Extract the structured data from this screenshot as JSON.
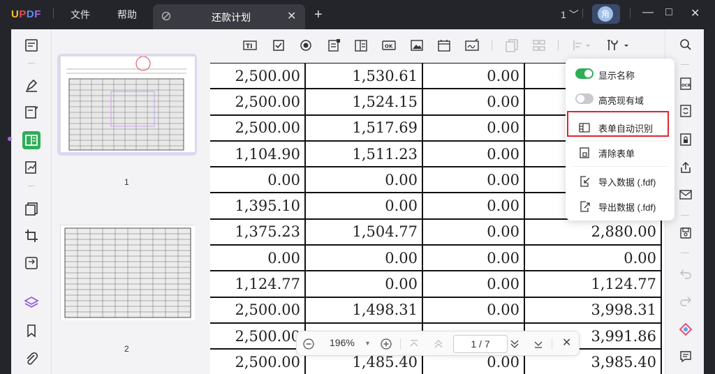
{
  "app": {
    "logo": "UPDF"
  },
  "menu": {
    "file": "文件",
    "help": "帮助"
  },
  "tab": {
    "title": "还款计划",
    "close": "✕"
  },
  "new_tab": "+",
  "page_selector": "1",
  "avatar_text": "角",
  "window": {
    "minimize": "—",
    "maximize": "□",
    "close": "✕"
  },
  "thumbnails": [
    {
      "number": "1"
    },
    {
      "number": "2"
    }
  ],
  "table_rows": [
    [
      "2,500.00",
      "1,530.61",
      "0.00",
      ""
    ],
    [
      "2,500.00",
      "1,524.15",
      "0.00",
      ""
    ],
    [
      "2,500.00",
      "1,517.69",
      "0.00",
      ""
    ],
    [
      "1,104.90",
      "1,511.23",
      "0.00",
      ""
    ],
    [
      "0.00",
      "0.00",
      "0.00",
      ""
    ],
    [
      "1,395.10",
      "0.00",
      "0.00",
      ""
    ],
    [
      "1,375.23",
      "1,504.77",
      "0.00",
      "2,880.00"
    ],
    [
      "0.00",
      "0.00",
      "0.00",
      "0.00"
    ],
    [
      "1,124.77",
      "0.00",
      "0.00",
      "1,124.77"
    ],
    [
      "2,500.00",
      "1,498.31",
      "0.00",
      "3,998.31"
    ],
    [
      "2,500.00",
      "",
      "",
      "3,991.86"
    ],
    [
      "2,500.00",
      "1,485.40",
      "0.00",
      "3,985.40"
    ]
  ],
  "dropdown": {
    "show_names": "显示名称",
    "highlight_fields": "高亮现有域",
    "auto_recognize": "表单自动识别",
    "clear_form": "清除表单",
    "import_data": "导入数据 (.fdf)",
    "export_data": "导出数据 (.fdf)"
  },
  "zoom": {
    "level": "196%",
    "page_display": "1 / 7"
  },
  "colors": {
    "accent_green": "#2eae57",
    "highlight_red": "#e0242f",
    "thumb_selected": "#dcd7f1"
  }
}
